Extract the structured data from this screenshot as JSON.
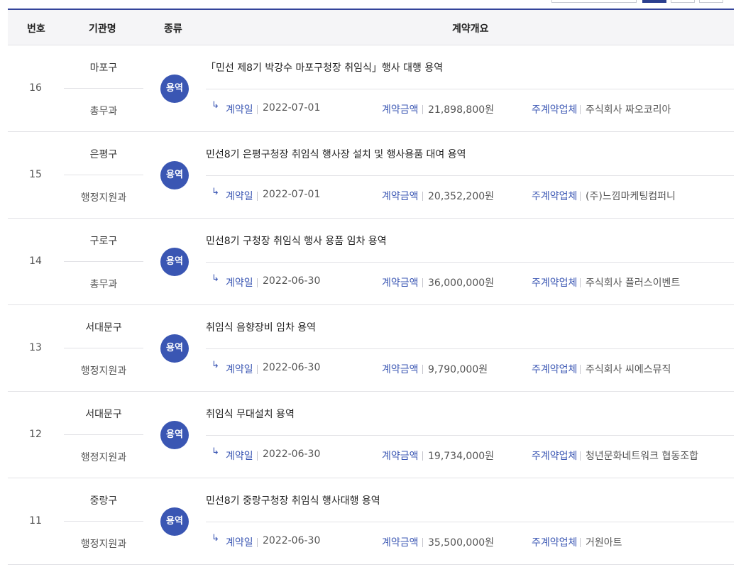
{
  "header": {
    "no": "번호",
    "org": "기관명",
    "kind": "종류",
    "summary": "계약개요"
  },
  "labels": {
    "date": "계약일",
    "amount": "계약금액",
    "vendor": "주계약업체"
  },
  "accent": "#3a56b3",
  "rows": [
    {
      "no": "16",
      "org": "마포구",
      "dept": "총무과",
      "kind": "용역",
      "title": "「민선 제8기 박강수 마포구청장 취임식」행사 대행 용역",
      "date": "2022-07-01",
      "amount": "21,898,800원",
      "vendor": "주식회사 짜오코리아"
    },
    {
      "no": "15",
      "org": "은평구",
      "dept": "행정지원과",
      "kind": "용역",
      "title": "민선8기 은평구청장 취임식 행사장 설치 및 행사용품 대여 용역",
      "date": "2022-07-01",
      "amount": "20,352,200원",
      "vendor": "(주)느낌마케팅컴퍼니"
    },
    {
      "no": "14",
      "org": "구로구",
      "dept": "총무과",
      "kind": "용역",
      "title": "민선8기 구청장 취임식 행사 용품 임차 용역",
      "date": "2022-06-30",
      "amount": "36,000,000원",
      "vendor": "주식회사 플러스이벤트"
    },
    {
      "no": "13",
      "org": "서대문구",
      "dept": "행정지원과",
      "kind": "용역",
      "title": "취임식 음향장비 임차 용역",
      "date": "2022-06-30",
      "amount": "9,790,000원",
      "vendor": "주식회사 씨에스뮤직"
    },
    {
      "no": "12",
      "org": "서대문구",
      "dept": "행정지원과",
      "kind": "용역",
      "title": "취임식 무대설치 용역",
      "date": "2022-06-30",
      "amount": "19,734,000원",
      "vendor": "청년문화네트워크 협동조합"
    },
    {
      "no": "11",
      "org": "중랑구",
      "dept": "행정지원과",
      "kind": "용역",
      "title": "민선8기 중랑구청장 취임식 행사대행 용역",
      "date": "2022-06-30",
      "amount": "35,500,000원",
      "vendor": "거원아트"
    }
  ]
}
